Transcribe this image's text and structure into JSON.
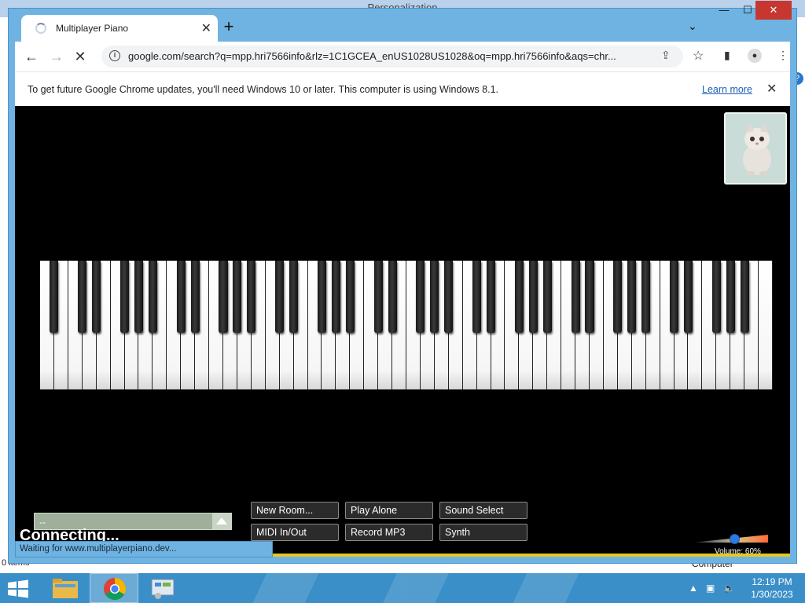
{
  "background_window": {
    "title": "Personalization",
    "status_left": "0 items",
    "status_right": "Computer"
  },
  "browser": {
    "tab": {
      "title": "Multiplayer Piano"
    },
    "address_bar": {
      "url": "google.com/search?q=mpp.hri7566info&rlz=1C1GCEA_enUS1028US1028&oq=mpp.hri7566info&aqs=chr..."
    },
    "infobar": {
      "message": "To get future Google Chrome updates, you'll need Windows 10 or later. This computer is using Windows 8.1.",
      "learn_more": "Learn more"
    },
    "status_bubble": "Waiting for www.multiplayerpiano.dev..."
  },
  "page": {
    "chat_input_value": "--",
    "connecting_text": "Connecting...",
    "buttons": {
      "new_room": "New Room...",
      "play_alone": "Play Alone",
      "sound_select": "Sound Select",
      "midi": "MIDI In/Out",
      "record_mp3": "Record MP3",
      "synth": "Synth"
    },
    "volume": {
      "label": "Volume: 60%",
      "value": 0.6
    },
    "piano": {
      "white_keys": 52
    }
  },
  "taskbar": {
    "time": "12:19 PM",
    "date": "1/30/2023",
    "apps": [
      "file-explorer",
      "chrome",
      "control-panel"
    ]
  },
  "colors": {
    "chrome_frame": "#6fb3e2",
    "taskbar": "#3b8fc8",
    "page_bg": "#000000",
    "accent_yellow": "#e8c81c",
    "volume_knob": "#2d7be0"
  }
}
